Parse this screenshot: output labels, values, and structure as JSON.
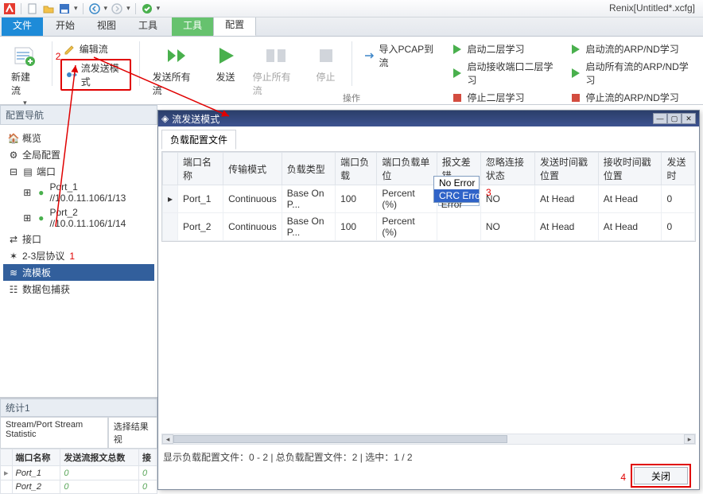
{
  "app_title": "Renix[Untitled*.xcfg]",
  "ribbon": {
    "tabs": {
      "file": "文件",
      "start": "开始",
      "view": "视图",
      "tools": "工具",
      "config": "配置",
      "tools_context": "工具"
    },
    "new_stream": "新建流",
    "edit_stream": "编辑流",
    "send_mode": "流发送模式",
    "send_all": "发送所有流",
    "send": "发送",
    "stop_all": "停止所有流",
    "stop": "停止",
    "import_pcap": "导入PCAP到流",
    "l2_learn_start": "启动二层学习",
    "l2_learn_rx_start": "启动接收端口二层学习",
    "l2_learn_stop": "停止二层学习",
    "arp_start": "启动流的ARP/ND学习",
    "arp_all_start": "启动所有流的ARP/ND学习",
    "arp_stop": "停止流的ARP/ND学习",
    "group_label": "操作"
  },
  "annotations": {
    "one": "1",
    "two": "2",
    "three": "3",
    "four": "4"
  },
  "nav": {
    "header": "配置导航",
    "overview": "概览",
    "global": "全局配置",
    "ports": "端口",
    "port1": "Port_1 //10.0.11.106/1/13",
    "port2": "Port_2 //10.0.11.106/1/14",
    "interfaces": "接口",
    "l23": "2-3层协议",
    "template": "流模板",
    "capture": "数据包捕获"
  },
  "stats": {
    "header": "统计1",
    "tab1": "Stream/Port Stream Statistic",
    "tab2": "选择结果视",
    "col_port": "端口名称",
    "col_sent": "发送流报文总数",
    "col_rx": "接",
    "rows": [
      {
        "port": "Port_1",
        "sent": "0",
        "rx": "0"
      },
      {
        "port": "Port_2",
        "sent": "0",
        "rx": "0"
      }
    ]
  },
  "dialog": {
    "title": "流发送模式",
    "tab": "负载配置文件",
    "cols": {
      "port": "端口名称",
      "mode": "传输模式",
      "loadtype": "负载类型",
      "load": "端口负载",
      "unit": "端口负载单位",
      "err": "报文差错",
      "ignore": "忽略连接状态",
      "txpos": "发送时间戳位置",
      "rxpos": "接收时间戳位置",
      "txtime": "发送时"
    },
    "rows": [
      {
        "port": "Port_1",
        "mode": "Continuous",
        "loadtype": "Base On P...",
        "load": "100",
        "unit": "Percent (%)",
        "err": "No Error",
        "ignore": "NO",
        "txpos": "At Head",
        "rxpos": "At Head",
        "txtime": "0"
      },
      {
        "port": "Port_2",
        "mode": "Continuous",
        "loadtype": "Base On P...",
        "load": "100",
        "unit": "Percent (%)",
        "err": "",
        "ignore": "NO",
        "txpos": "At Head",
        "rxpos": "At Head",
        "txtime": "0"
      }
    ],
    "dropdown": {
      "opt1": "No Error",
      "opt2": "CRC Error"
    },
    "status": "显示负载配置文件：0 - 2 | 总负载配置文件：2 | 选中：1 / 2",
    "close": "关闭"
  }
}
